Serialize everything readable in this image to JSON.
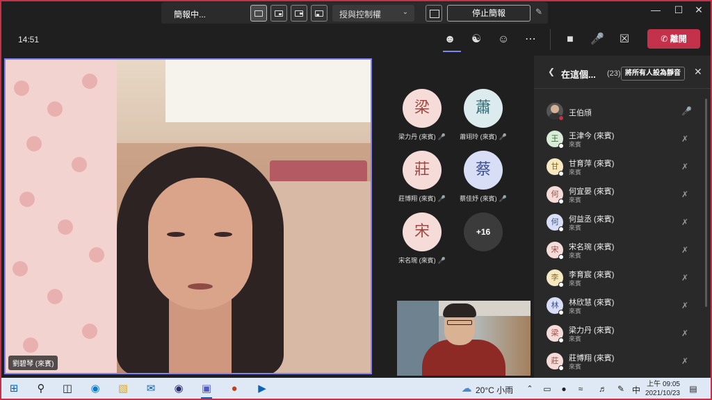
{
  "titlebar": {
    "present_status": "簡報中...",
    "control_dropdown": "授與控制權",
    "stop_presenting": "停止簡報",
    "window_controls": [
      "—",
      "☐",
      "✕"
    ]
  },
  "toolbar": {
    "time": "14:51",
    "leave_label": "離開"
  },
  "main_video": {
    "name": "劉碧琴 (來賓)"
  },
  "gallery": {
    "participants": [
      {
        "initial": "梁",
        "name": "梁力丹 (來賓)",
        "bg": "#f6dcd9",
        "fg": "#9a4a42"
      },
      {
        "initial": "蕭",
        "name": "蕭翊玲 (來賓)",
        "bg": "#dcebee",
        "fg": "#3c6c73"
      },
      {
        "initial": "莊",
        "name": "莊博翔 (來賓)",
        "bg": "#f6dcd9",
        "fg": "#9a4a42"
      },
      {
        "initial": "蔡",
        "name": "蔡佳妤 (來賓)",
        "bg": "#d7def5",
        "fg": "#3d4f8f"
      },
      {
        "initial": "宋",
        "name": "宋名琬 (來賓)",
        "bg": "#f6dcd9",
        "fg": "#9a4a42"
      }
    ],
    "more_count": "+16"
  },
  "panel": {
    "title": "在這個...",
    "count": "(23)",
    "mute_all": "將所有人設為靜音",
    "role_label": "來賓",
    "participants": [
      {
        "name": "王伯頎",
        "initial": "",
        "bg": "",
        "fg": "",
        "role": "",
        "mic": "on"
      },
      {
        "name": "王津今 (來賓)",
        "initial": "王",
        "bg": "#d9ecd8",
        "fg": "#3f6e3c",
        "role": "來賓",
        "mic": "off"
      },
      {
        "name": "甘育萍 (來賓)",
        "initial": "甘",
        "bg": "#f6e9c2",
        "fg": "#8a6b1f",
        "role": "來賓",
        "mic": "off"
      },
      {
        "name": "何宜晏 (來賓)",
        "initial": "何",
        "bg": "#f6dcd9",
        "fg": "#9a4a42",
        "role": "來賓",
        "mic": "off"
      },
      {
        "name": "何益丞 (來賓)",
        "initial": "何",
        "bg": "#d7def5",
        "fg": "#3d4f8f",
        "role": "來賓",
        "mic": "off"
      },
      {
        "name": "宋名琬 (來賓)",
        "initial": "宋",
        "bg": "#f6dcd9",
        "fg": "#9a4a42",
        "role": "來賓",
        "mic": "off"
      },
      {
        "name": "李育宸 (來賓)",
        "initial": "李",
        "bg": "#f6e9c2",
        "fg": "#8a6b1f",
        "role": "來賓",
        "mic": "off"
      },
      {
        "name": "林欣慧 (來賓)",
        "initial": "林",
        "bg": "#d7def5",
        "fg": "#3d4f8f",
        "role": "來賓",
        "mic": "off"
      },
      {
        "name": "梁力丹 (來賓)",
        "initial": "梁",
        "bg": "#f6dcd9",
        "fg": "#9a4a42",
        "role": "來賓",
        "mic": "off"
      },
      {
        "name": "莊博翔 (來賓)",
        "initial": "莊",
        "bg": "#f6dcd9",
        "fg": "#9a4a42",
        "role": "來賓",
        "mic": "off"
      }
    ]
  },
  "taskbar": {
    "weather": "20°C 小雨",
    "ime": "中",
    "time": "上午 09:05",
    "date": "2021/10/23"
  }
}
